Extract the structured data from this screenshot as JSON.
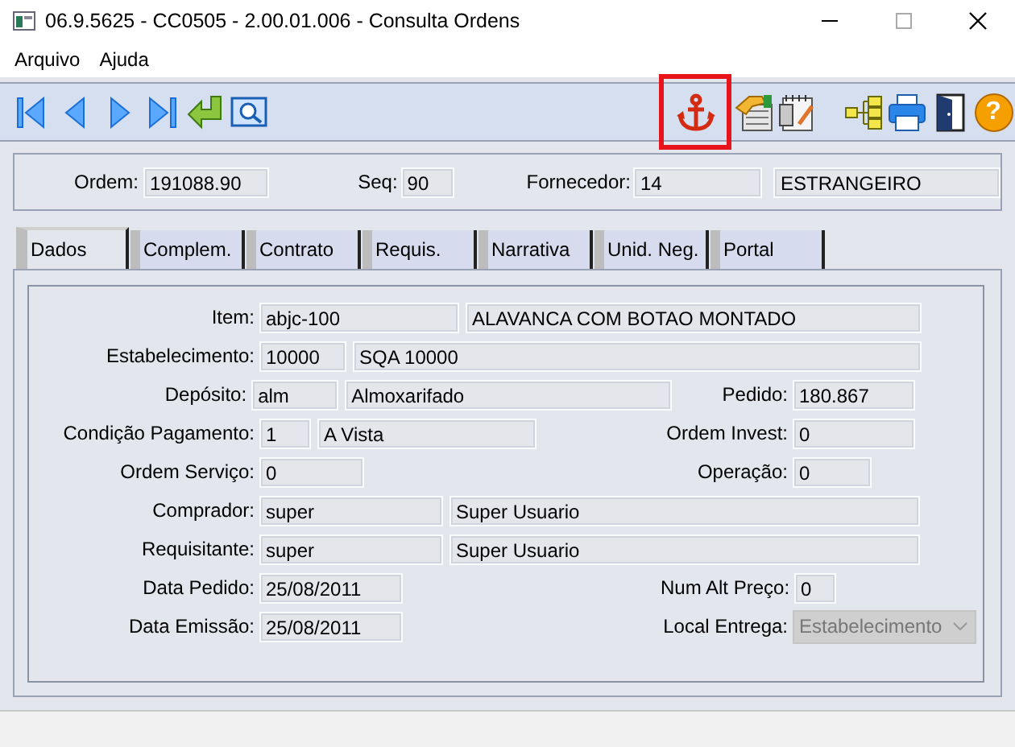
{
  "window": {
    "title": "06.9.5625 - CC0505 - 2.00.01.006 - Consulta Ordens"
  },
  "menu": [
    "Arquivo",
    "Ajuda"
  ],
  "toolbar": [
    {
      "kind": "first",
      "highlighted": false
    },
    {
      "kind": "prev",
      "highlighted": false
    },
    {
      "kind": "next",
      "highlighted": false
    },
    {
      "kind": "last",
      "highlighted": false
    },
    {
      "kind": "enter",
      "highlighted": false
    },
    {
      "kind": "preview",
      "highlighted": false
    },
    {
      "kind": "gap"
    },
    {
      "kind": "anchor",
      "highlighted": true
    },
    {
      "kind": "handdoc",
      "highlighted": false
    },
    {
      "kind": "notepad",
      "highlighted": false
    },
    {
      "kind": "gap"
    },
    {
      "kind": "tree",
      "highlighted": false
    },
    {
      "kind": "printer",
      "highlighted": false
    },
    {
      "kind": "door",
      "highlighted": false
    },
    {
      "kind": "help",
      "glyph": "?",
      "highlighted": false
    }
  ],
  "header": [
    {
      "label": "Ordem:",
      "value": "191088.90"
    },
    {
      "label": "Seq:",
      "value": "90"
    },
    {
      "label": "Fornecedor:",
      "value": "14"
    },
    {
      "value": "ESTRANGEIRO"
    }
  ],
  "tabs": [
    {
      "label": "Dados",
      "selected": true
    },
    {
      "label": "Complem.",
      "selected": false
    },
    {
      "label": "Contrato",
      "selected": false
    },
    {
      "label": "Requis.",
      "selected": false
    },
    {
      "label": "Narrativa",
      "selected": false
    },
    {
      "label": "Unid. Neg.",
      "selected": false
    },
    {
      "label": "Portal",
      "selected": false
    }
  ],
  "form": [
    {
      "label": "Item:",
      "values": [
        "abjc-100",
        "ALAVANCA COM BOTAO MONTADO"
      ]
    },
    {
      "label": "Estabelecimento:",
      "values": [
        "10000",
        "SQA 10000"
      ]
    },
    {
      "label": "Depósito:",
      "values": [
        "alm",
        "Almoxarifado"
      ],
      "right": {
        "kind": "text",
        "label": "Pedido:",
        "value": "180.867"
      }
    },
    {
      "label": "Condição Pagamento:",
      "values": [
        "1",
        "A Vista"
      ],
      "right": {
        "kind": "text",
        "label": "Ordem Invest:",
        "value": "0"
      }
    },
    {
      "label": "Ordem Serviço:",
      "values": [
        "0"
      ],
      "right": {
        "kind": "text",
        "label": "Operação:",
        "value": "0"
      }
    },
    {
      "label": "Comprador:",
      "values": [
        "super",
        "Super Usuario"
      ]
    },
    {
      "label": "Requisitante:",
      "values": [
        "super",
        "Super Usuario"
      ]
    },
    {
      "label": "Data Pedido:",
      "values": [
        "25/08/2011"
      ],
      "right": {
        "kind": "text",
        "label": "Num Alt Preço:",
        "value": "0"
      }
    },
    {
      "label": "Data Emissão:",
      "values": [
        "25/08/2011"
      ],
      "right": {
        "kind": "dropdown",
        "label": "Local Entrega:",
        "value": "Estabelecimento",
        "disabled": true
      }
    }
  ]
}
